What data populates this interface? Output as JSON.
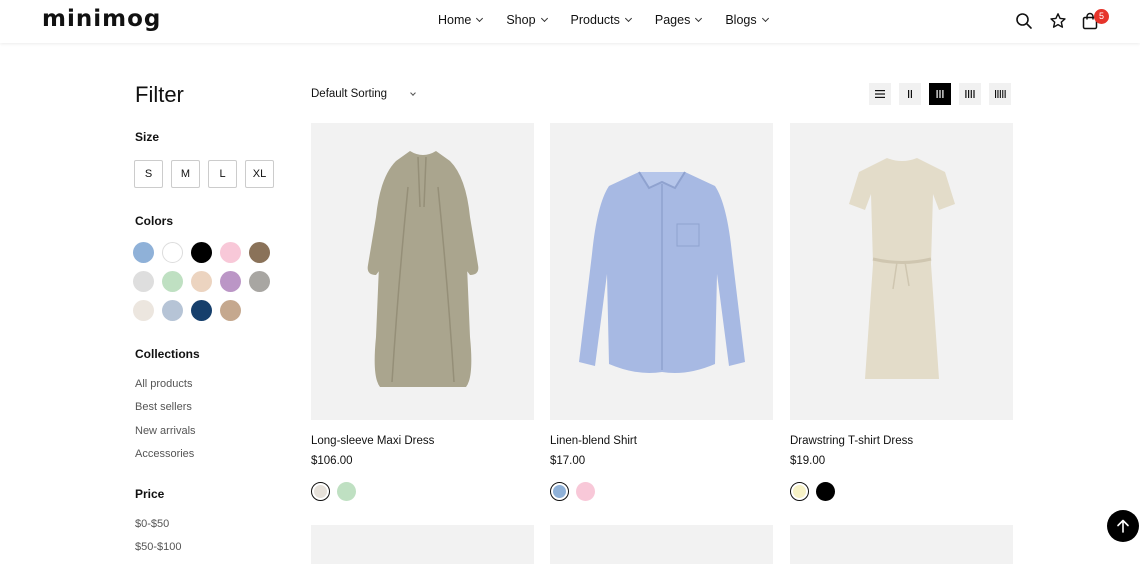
{
  "header": {
    "logo": "minimog",
    "nav": [
      {
        "label": "Home"
      },
      {
        "label": "Shop"
      },
      {
        "label": "Products"
      },
      {
        "label": "Pages"
      },
      {
        "label": "Blogs"
      }
    ],
    "cart_count": "5"
  },
  "sidebar": {
    "title": "Filter",
    "size_title": "Size",
    "sizes": [
      "S",
      "M",
      "L",
      "XL"
    ],
    "colors_title": "Colors",
    "colors": [
      "#8fb1d8",
      "#ffffff",
      "#000000",
      "#f8c8d8",
      "#8a7259",
      "#dedede",
      "#bfe0c2",
      "#ecd4c0",
      "#bb96c6",
      "#a8a6a2",
      "#ece6df",
      "#b6c4d6",
      "#163f6c",
      "#c5a88e"
    ],
    "collections_title": "Collections",
    "collections": [
      "All products",
      "Best sellers",
      "New arrivals",
      "Accessories"
    ],
    "price_title": "Price",
    "prices": [
      "$0-$50",
      "$50-$100"
    ]
  },
  "toolbar": {
    "sort_label": "Default Sorting"
  },
  "products": [
    {
      "name": "Long-sleeve Maxi Dress",
      "price": "$106.00",
      "swatches": [
        "#e6e1da",
        "#bfe0c2"
      ],
      "image": "dress-khaki"
    },
    {
      "name": "Linen-blend Shirt",
      "price": "$17.00",
      "swatches": [
        "#8fb1d8",
        "#f8c8d8"
      ],
      "image": "shirt-blue"
    },
    {
      "name": "Drawstring T-shirt Dress",
      "price": "$19.00",
      "swatches": [
        "#f7f2c6",
        "#000000"
      ],
      "image": "dress-beige"
    }
  ]
}
